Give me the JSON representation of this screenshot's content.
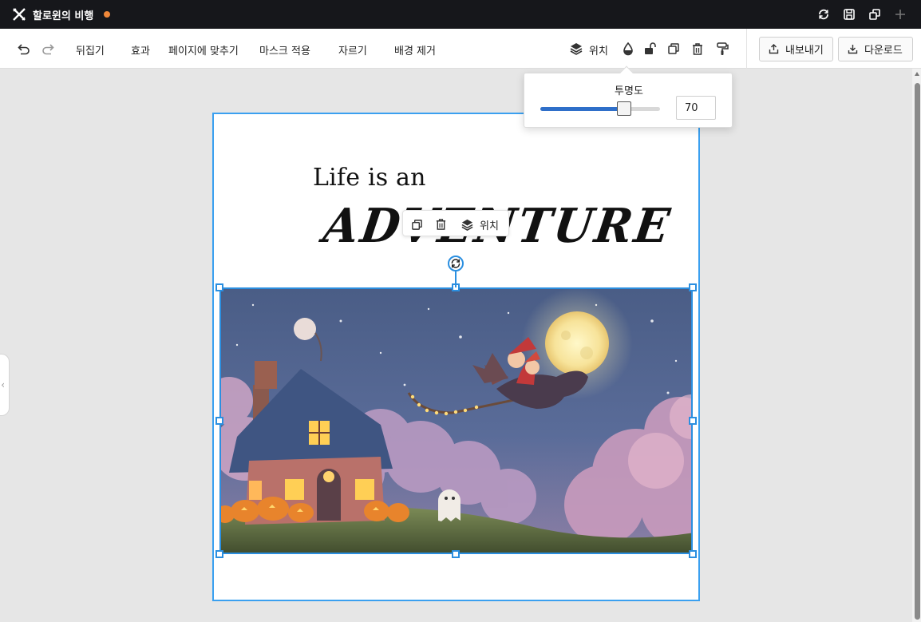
{
  "app": {
    "title": "할로윈의 비행",
    "unsaved_color": "#f0883a"
  },
  "toolbar": {
    "undo_icon": "undo-icon",
    "redo_icon": "redo-icon",
    "flip": "뒤집기",
    "effects": "효과",
    "fit_page": "페이지에 맞추기",
    "apply_mask": "마스크 적용",
    "crop": "자르기",
    "remove_bg": "배경 제거",
    "position": "위치",
    "export": "내보내기",
    "download": "다운로드"
  },
  "canvas": {
    "heading_line1": "Life is an",
    "heading_line2": "ADVENTURE",
    "float_toolbar_position": "위치",
    "accent_color": "#2b8fe0"
  },
  "opacity_popover": {
    "title": "투명도",
    "value": "70",
    "percent": 70
  }
}
